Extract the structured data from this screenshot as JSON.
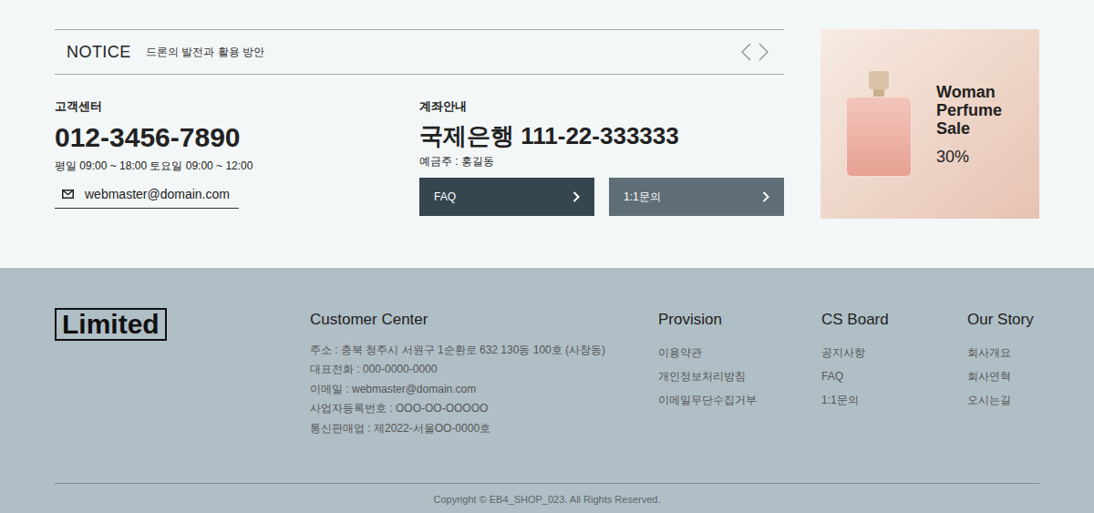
{
  "notice": {
    "label": "NOTICE",
    "title": "드론의 발전과 활용 방안"
  },
  "customer_center": {
    "title": "고객센터",
    "phone": "012-3456-7890",
    "hours": "평일 09:00 ~ 18:00 토요일 09:00 ~ 12:00",
    "email": "webmaster@domain.com"
  },
  "account": {
    "title": "계좌안내",
    "bank": "국제은행 111-22-333333",
    "holder": "예금주 : 홍길동"
  },
  "buttons": [
    {
      "label": "FAQ",
      "color": "#36464f"
    },
    {
      "label": "1:1문의",
      "color": "#5f6e76"
    }
  ],
  "banner": {
    "lines": [
      "Woman",
      "Perfume",
      "Sale"
    ],
    "discount": "30%"
  },
  "footer": {
    "logo": "Limited",
    "columns": [
      {
        "title": "Customer Center",
        "items": [
          "주소 : 충북 청주시 서원구 1순환로 632 130동 100호 (사창동)",
          "대표전화 : 000-0000-0000",
          "이메일 : webmaster@domain.com",
          "사업자등록번호 : OOO-OO-OOOOO",
          "통신판매업 : 제2022-서울OO-0000호"
        ]
      },
      {
        "title": "Provision",
        "items": [
          "이용약관",
          "개인정보처리방침",
          "이메일무단수집거부"
        ]
      },
      {
        "title": "CS Board",
        "items": [
          "공지사항",
          "FAQ",
          "1:1문의"
        ]
      },
      {
        "title": "Our Story",
        "items": [
          "회사개요",
          "회사연혁",
          "오시는길"
        ]
      }
    ],
    "copyright": "Copyright © EB4_SHOP_023. All Rights Reserved."
  }
}
